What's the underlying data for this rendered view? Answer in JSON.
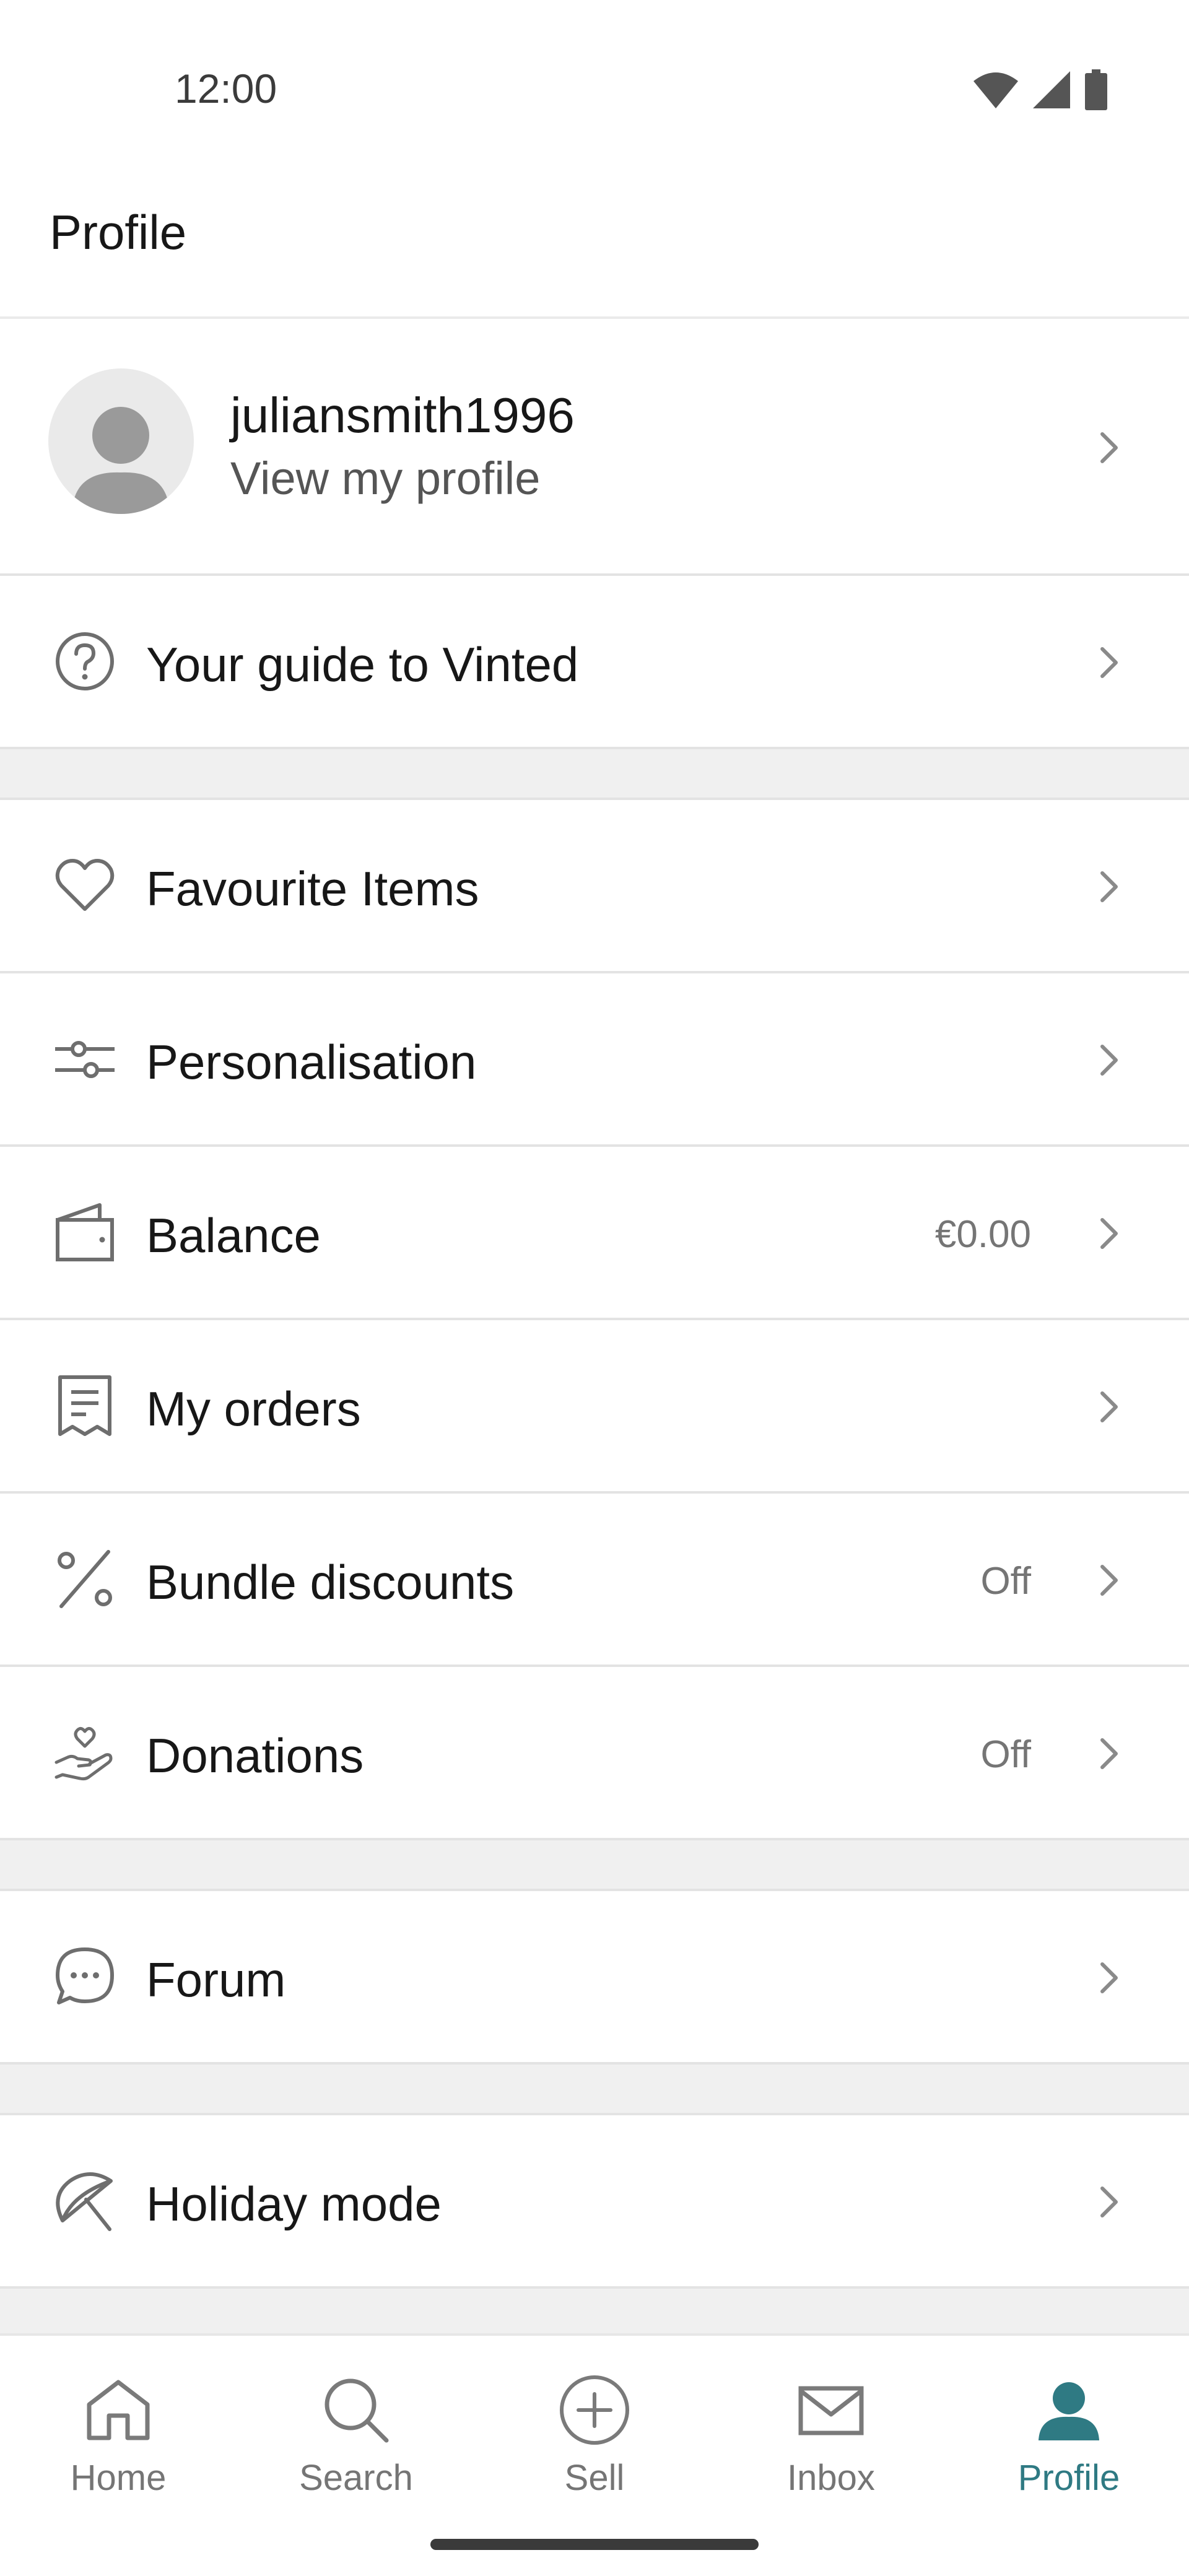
{
  "status_bar": {
    "time": "12:00",
    "icons": [
      "wifi-icon",
      "signal-icon",
      "battery-icon"
    ]
  },
  "header": {
    "title": "Profile"
  },
  "profile": {
    "username": "juliansmith1996",
    "subtitle": "View my profile",
    "avatar_icon": "avatar-placeholder-icon"
  },
  "menu": {
    "guide": {
      "label": "Your guide to Vinted",
      "icon": "help-circle-icon"
    },
    "favourites": {
      "label": "Favourite Items",
      "icon": "heart-icon"
    },
    "personalisation": {
      "label": "Personalisation",
      "icon": "sliders-icon"
    },
    "balance": {
      "label": "Balance",
      "value": "€0.00",
      "icon": "wallet-icon"
    },
    "orders": {
      "label": "My orders",
      "icon": "receipt-icon"
    },
    "bundle": {
      "label": "Bundle discounts",
      "value": "Off",
      "icon": "percent-icon"
    },
    "donations": {
      "label": "Donations",
      "value": "Off",
      "icon": "donation-hand-icon"
    },
    "forum": {
      "label": "Forum",
      "icon": "chat-bubble-icon"
    },
    "holiday": {
      "label": "Holiday mode",
      "icon": "umbrella-icon"
    }
  },
  "bottom_nav": {
    "home": "Home",
    "search": "Search",
    "sell": "Sell",
    "inbox": "Inbox",
    "profile": "Profile",
    "active": "Profile"
  },
  "colors": {
    "accent": "#2f7a83",
    "text": "#171717",
    "muted": "#757575",
    "divider_band": "#f0f0f0"
  }
}
